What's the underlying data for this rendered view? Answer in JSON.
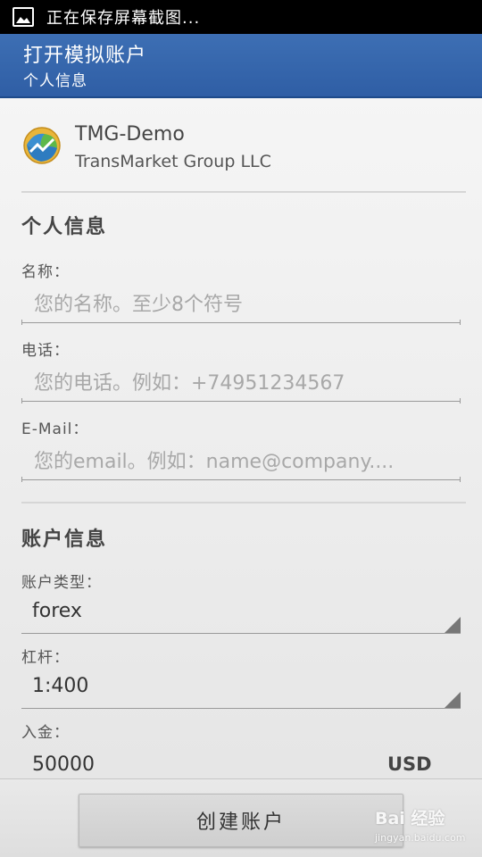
{
  "status_bar": {
    "notification_text": "正在保存屏幕截图..."
  },
  "action_bar": {
    "title": "打开模拟账户",
    "subtitle": "个人信息"
  },
  "broker": {
    "name": "TMG-Demo",
    "company": "TransMarket Group LLC"
  },
  "personal_section": {
    "title": "个人信息",
    "name_label": "名称：",
    "name_placeholder": "您的名称。至少8个符号",
    "phone_label": "电话：",
    "phone_placeholder": "您的电话。例如：+74951234567",
    "email_label": "E-Mail：",
    "email_placeholder": "您的email。例如：name@company...."
  },
  "account_section": {
    "title": "账户信息",
    "type_label": "账户类型：",
    "type_value": "forex",
    "leverage_label": "杠杆：",
    "leverage_value": "1:400",
    "deposit_label": "入金：",
    "deposit_value": "50000",
    "deposit_currency": "USD"
  },
  "footer": {
    "create_button_label": "创建账户"
  },
  "watermark": {
    "brand": "Bai 经验",
    "url": "jingyan.baidu.com"
  },
  "colors": {
    "action_bar": "#2f5ea5",
    "status_bar": "#000000"
  }
}
